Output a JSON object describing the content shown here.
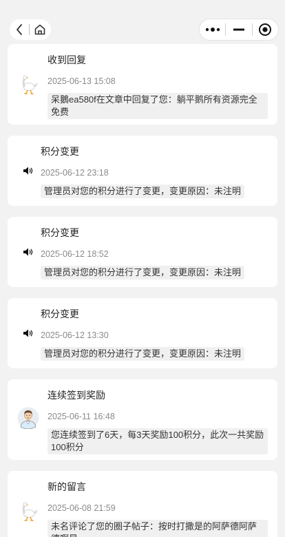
{
  "nav": {
    "back_icon": "chevron-left-icon",
    "home_icon": "home-icon",
    "more_icon": "more-dots-icon",
    "minimize_icon": "minimize-icon",
    "close_icon": "target-close-icon"
  },
  "notifications": [
    {
      "title": "收到回复",
      "time": "2025-06-13 15:08",
      "message": "呆鵝ea580f在文章中回复了您：躺平鹅所有资源完全免费",
      "icon": "goose-avatar-icon"
    },
    {
      "title": "积分变更",
      "time": "2025-06-12 23:18",
      "message": "管理员对您的积分进行了变更，变更原因：未注明",
      "icon": "speaker-icon"
    },
    {
      "title": "积分变更",
      "time": "2025-06-12 18:52",
      "message": "管理员对您的积分进行了变更，变更原因：未注明",
      "icon": "speaker-icon"
    },
    {
      "title": "积分变更",
      "time": "2025-06-12 13:30",
      "message": "管理员对您的积分进行了变更，变更原因：未注明",
      "icon": "speaker-icon"
    },
    {
      "title": "连续签到奖励",
      "time": "2025-06-11 16:48",
      "message": "您连续签到了6天，每3天奖励100积分，此次一共奖励100积分",
      "icon": "user-avatar-icon"
    },
    {
      "title": "新的留言",
      "time": "2025-06-08 21:59",
      "message": "未名评论了您的圈子帖子：按时打撒是的阿萨德阿萨德啊是",
      "icon": "goose-avatar-icon"
    }
  ]
}
